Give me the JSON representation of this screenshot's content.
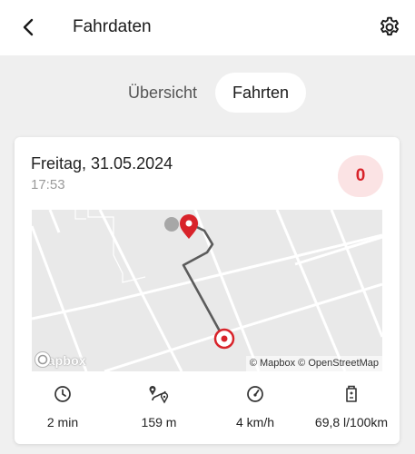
{
  "header": {
    "title": "Fahrdaten",
    "back_icon": "chevron-left-icon",
    "settings_icon": "gear-icon"
  },
  "tabs": [
    {
      "label": "Übersicht",
      "active": false
    },
    {
      "label": "Fahrten",
      "active": true
    }
  ],
  "trip": {
    "date": "Freitag, 31.05.2024",
    "time": "17:53",
    "score": "0",
    "score_color": "#d8232a",
    "score_bg": "#fbe3e4",
    "map": {
      "logo_text": "mapbox",
      "attribution": "© Mapbox © OpenStreetMap"
    },
    "stats": [
      {
        "icon": "clock-icon",
        "value": "2 min"
      },
      {
        "icon": "route-icon",
        "value": "159 m"
      },
      {
        "icon": "speedometer-icon",
        "value": "4 km/h"
      },
      {
        "icon": "fuel-pump-icon",
        "value": "69,8 l/100km"
      }
    ]
  },
  "colors": {
    "accent": "#d8232a",
    "route": "#555555",
    "map_bg": "#e9e9e9",
    "map_roads": "#ffffff"
  }
}
